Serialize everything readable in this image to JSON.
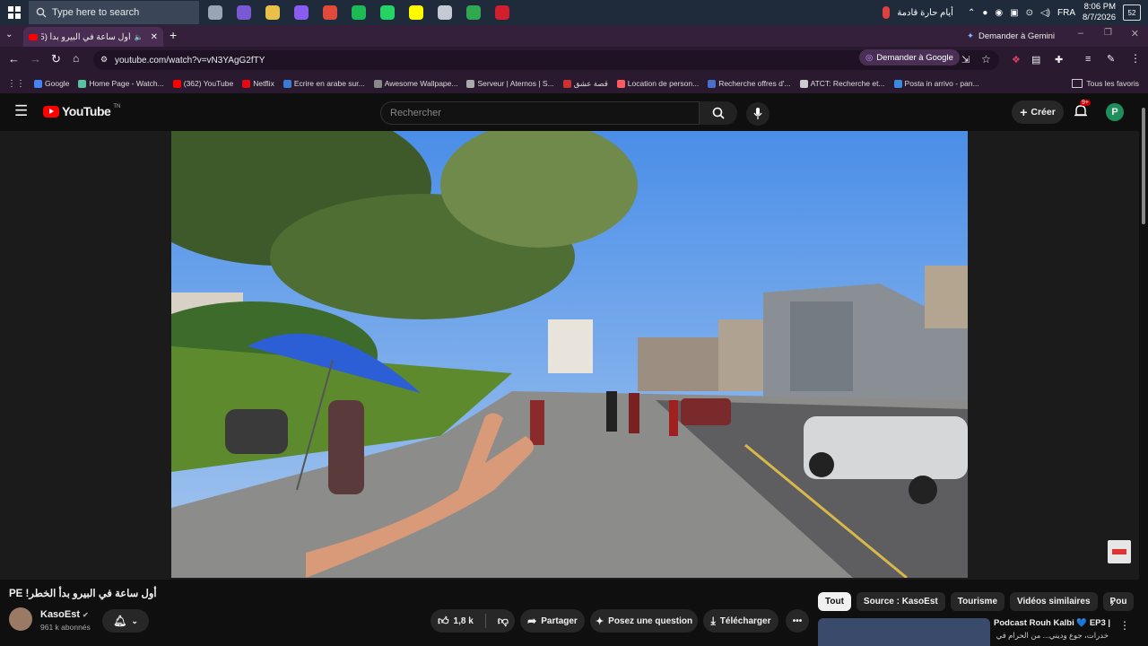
{
  "taskbar": {
    "search_placeholder": "Type here to search",
    "weather_text": "أيام حارة قادمة",
    "language": "FRA",
    "time": "8:06 PM",
    "date": "8/7/2026",
    "notification_count": "52",
    "apps": [
      {
        "name": "task-view-icon",
        "color": "#9aa4b2"
      },
      {
        "name": "hub-app-icon",
        "color": "#7a58d6"
      },
      {
        "name": "file-explorer-icon",
        "color": "#e8c04a"
      },
      {
        "name": "messenger-icon",
        "color": "#8a5cf0"
      },
      {
        "name": "chrome-icon",
        "color": "#e04a3a"
      },
      {
        "name": "spotify-icon",
        "color": "#1db954"
      },
      {
        "name": "whatsapp-icon",
        "color": "#25d366"
      },
      {
        "name": "snapchat-icon",
        "color": "#fffc00"
      },
      {
        "name": "steam-icon",
        "color": "#c6cbd3"
      },
      {
        "name": "xbox-icon",
        "color": "#2fa84f"
      },
      {
        "name": "vpn-icon",
        "color": "#d02030"
      }
    ]
  },
  "browser": {
    "tab_title": "أول ساعة في البيرو بدأ (285)",
    "gemini_label": "Demander à Gemini",
    "url": "youtube.com/watch?v=vN3YAgG2fTY",
    "ask_google_label": "Demander à Google",
    "bookmarks": [
      {
        "label": "Google",
        "color": "#4285f4"
      },
      {
        "label": "Home Page - Watch...",
        "color": "#5bc0a0"
      },
      {
        "label": "(362) YouTube",
        "color": "#ff0000"
      },
      {
        "label": "Netflix",
        "color": "#e50914"
      },
      {
        "label": "Ecrire en arabe sur...",
        "color": "#3a7bd5"
      },
      {
        "label": "Awesome Wallpape...",
        "color": "#888888"
      },
      {
        "label": "Serveur | Aternos | S...",
        "color": "#aaaaaa"
      },
      {
        "label": "قصة عشق",
        "color": "#d03030"
      },
      {
        "label": "Location de person...",
        "color": "#ff5a5f"
      },
      {
        "label": "Recherche offres d'...",
        "color": "#4a6fd0"
      },
      {
        "label": "ATCT: Recherche et...",
        "color": "#cccccc"
      },
      {
        "label": "Posta in arrivo - pan...",
        "color": "#3a8ae0"
      }
    ],
    "all_bookmarks_label": "Tous les favoris"
  },
  "youtube": {
    "logo_text": "YouTube",
    "logo_region": "TN",
    "search_placeholder": "Rechercher",
    "create_label": "Créer",
    "notif_badge": "9+",
    "avatar_letter": "P"
  },
  "video": {
    "title": "أول ساعة في البيرو بدأ الخطر! PE",
    "channel": "KasoEst",
    "subscribers": "961 k abonnés",
    "likes": "1,8 k",
    "share_label": "Partager",
    "ask_label": "Posez une question",
    "download_label": "Télécharger"
  },
  "chips": [
    "Tout",
    "Source : KasoEst",
    "Tourisme",
    "Vidéos similaires",
    "Pou"
  ],
  "recommendation": {
    "title": "Podcast Rouh Kalbi 💙 EP3 |",
    "subtitle": "خدرات، جوع وديني... من الحرام في الغربة"
  }
}
